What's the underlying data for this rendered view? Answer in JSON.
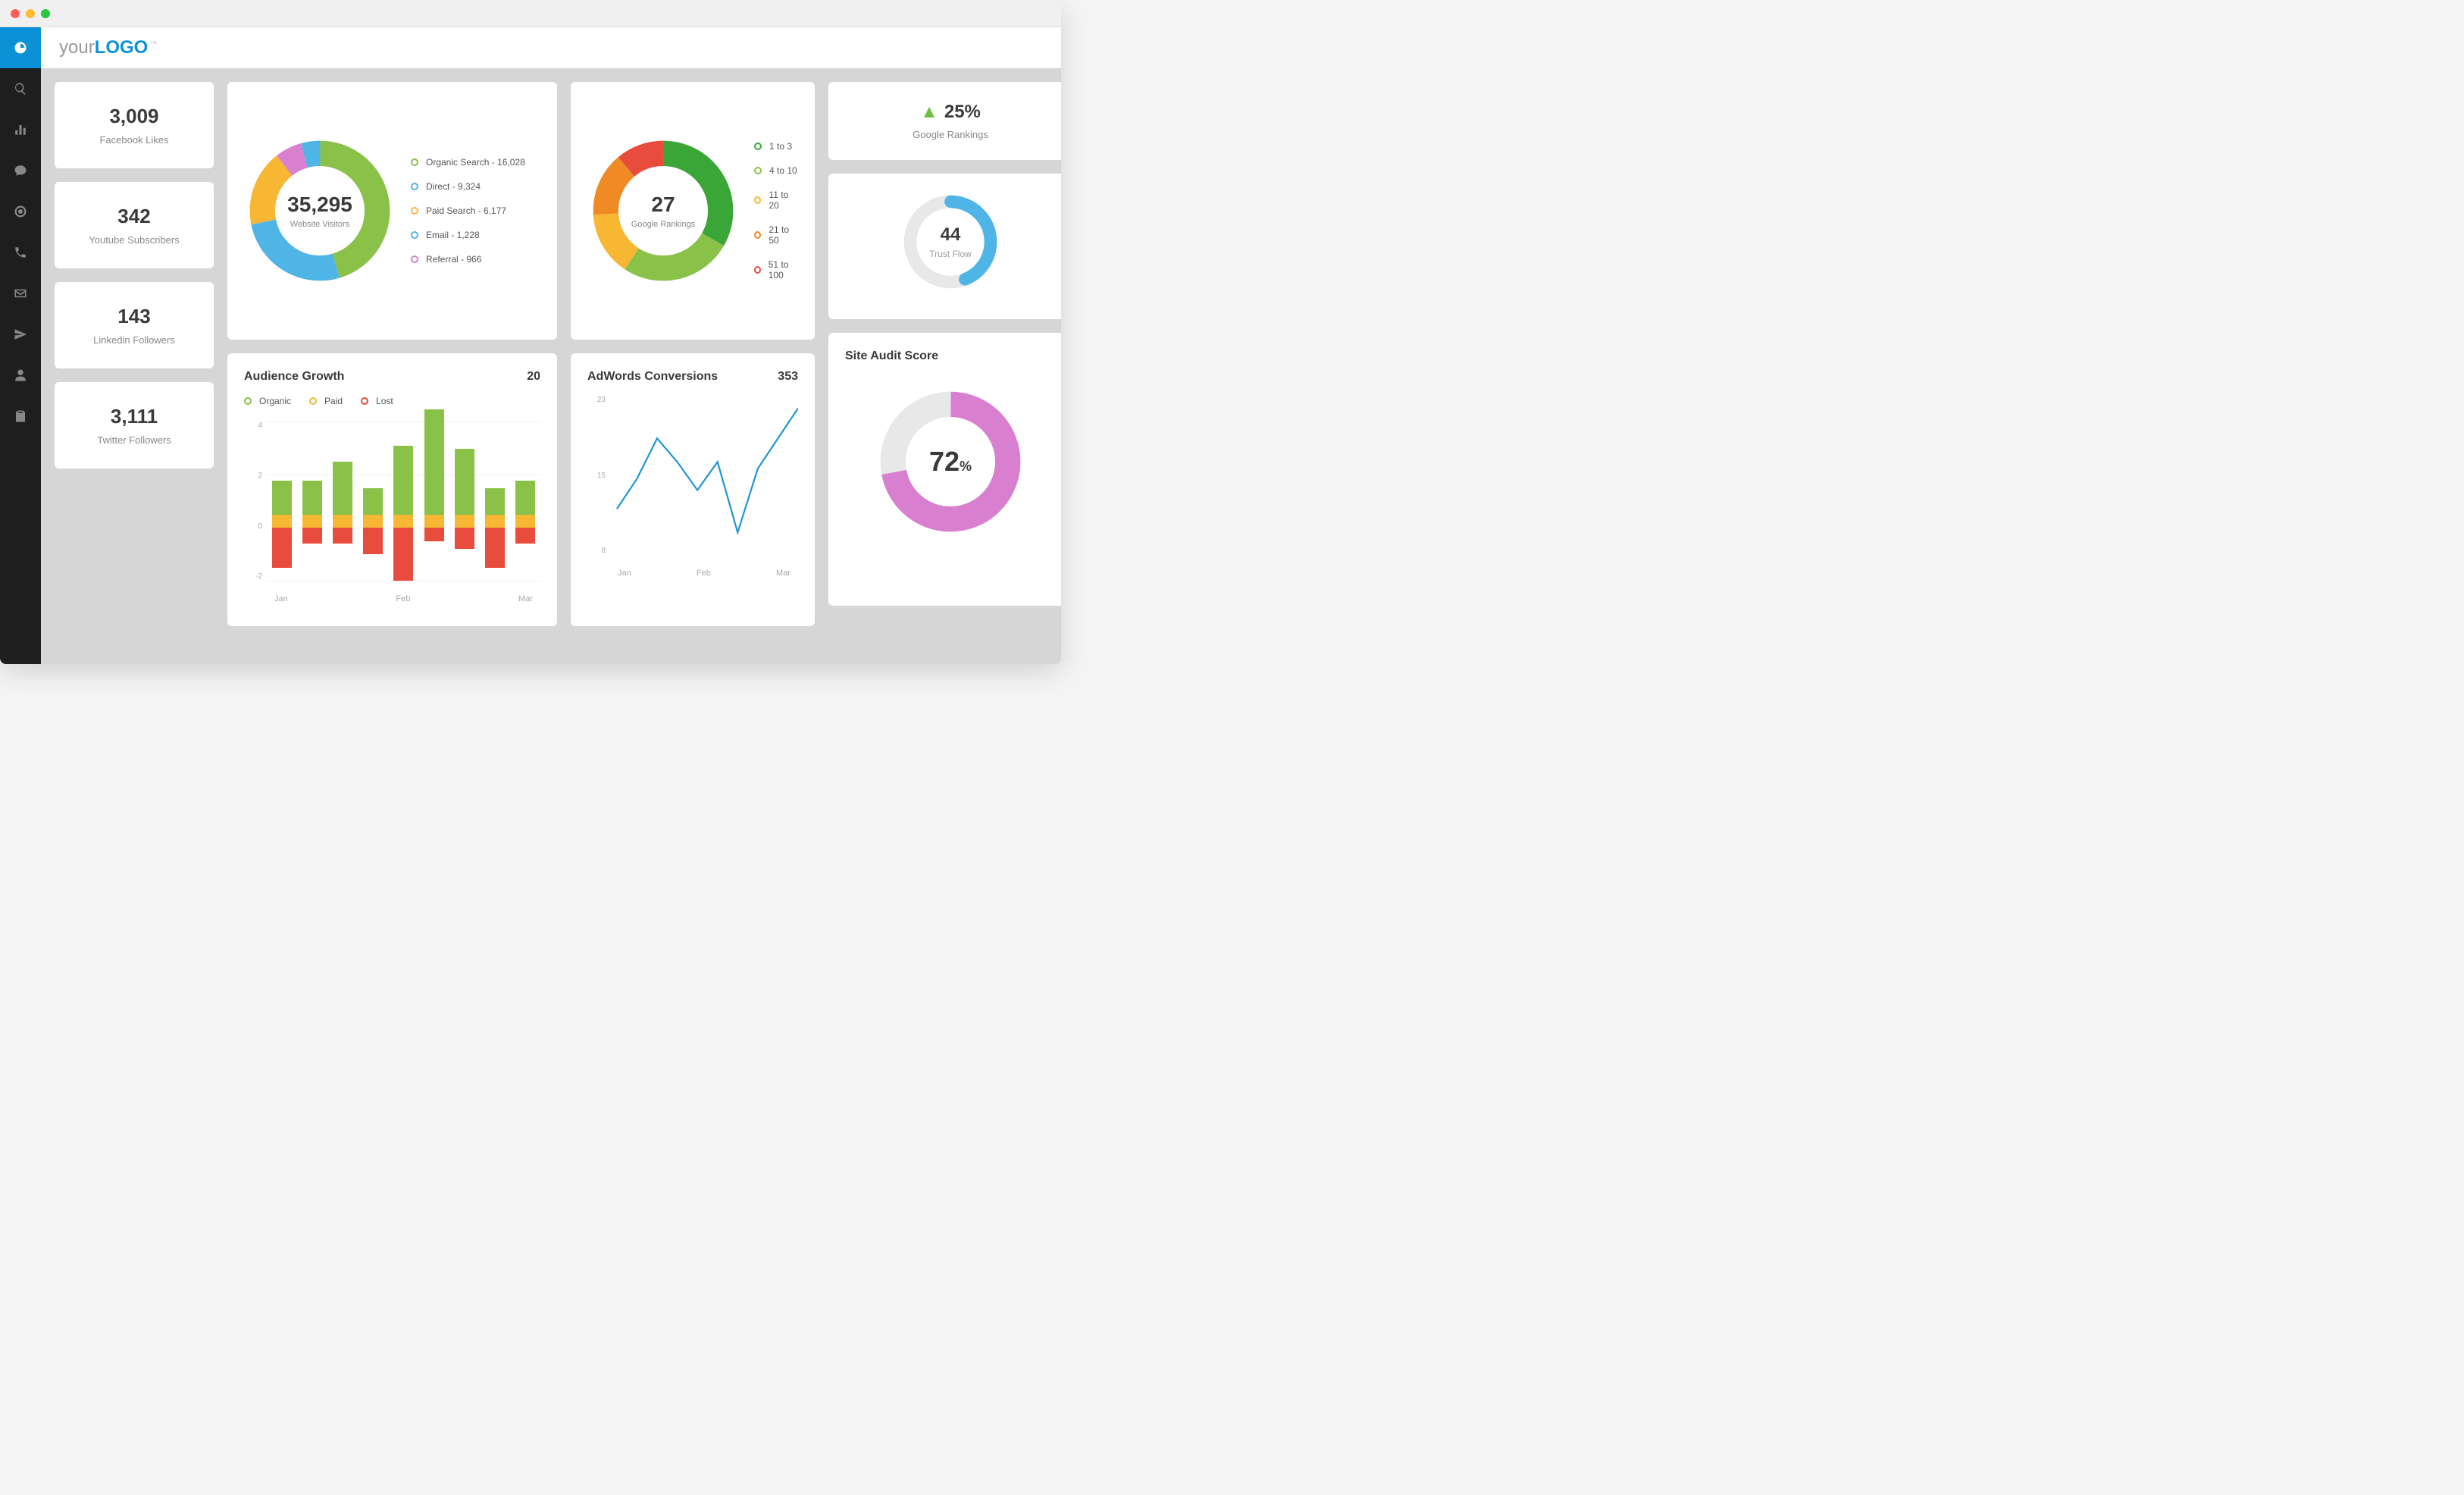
{
  "logo": {
    "pre": "your",
    "bold": "LOGO",
    "tm": "™"
  },
  "sidebar": {
    "items": [
      {
        "name": "dashboard-icon"
      },
      {
        "name": "search-icon"
      },
      {
        "name": "bar-chart-icon"
      },
      {
        "name": "chat-icon"
      },
      {
        "name": "target-icon"
      },
      {
        "name": "phone-icon"
      },
      {
        "name": "mail-icon"
      },
      {
        "name": "send-icon"
      },
      {
        "name": "user-icon"
      },
      {
        "name": "clipboard-icon"
      }
    ]
  },
  "stats": {
    "facebook_likes": {
      "value": "3,009",
      "label": "Facebook Likes"
    },
    "youtube": {
      "value": "342",
      "label": "Youtube Subscribers"
    },
    "linkedin": {
      "value": "143",
      "label": "Linkedin Followers"
    },
    "twitter": {
      "value": "3,111",
      "label": "Twitter Followers"
    }
  },
  "website_visitors": {
    "total": "35,295",
    "label": "Website Visitors",
    "legend": [
      {
        "label": "Organic Search - 16,028",
        "color": "#8ac149"
      },
      {
        "label": "Direct - 9,324",
        "color": "#4fb5e6"
      },
      {
        "label": "Paid Search - 6,177",
        "color": "#f7b733"
      },
      {
        "label": "Email - 1,228",
        "color": "#4fb5e6"
      },
      {
        "label": "Referral - 966",
        "color": "#d97fd0"
      }
    ]
  },
  "google_rankings": {
    "total": "27",
    "label": "Google Rankings",
    "legend": [
      {
        "label": "1 to 3",
        "color": "#3ba638"
      },
      {
        "label": "4 to 10",
        "color": "#8ac149"
      },
      {
        "label": "11 to 20",
        "color": "#f7b733"
      },
      {
        "label": "21 to 50",
        "color": "#f08a24"
      },
      {
        "label": "51 to 100",
        "color": "#e84c3d"
      }
    ]
  },
  "google_rankings_change": {
    "value": "25%",
    "label": "Google Rankings"
  },
  "trust_flow": {
    "value": "44",
    "label": "Trust Flow"
  },
  "audience_growth": {
    "title": "Audience Growth",
    "total": "20",
    "legend": [
      {
        "label": "Organic",
        "color": "#8ac149"
      },
      {
        "label": "Paid",
        "color": "#f7b733"
      },
      {
        "label": "Lost",
        "color": "#e84c3d"
      }
    ],
    "xaxis": [
      "Jan",
      "Feb",
      "Mar"
    ]
  },
  "adwords": {
    "title": "AdWords Conversions",
    "total": "353",
    "xaxis": [
      "Jan",
      "Feb",
      "Mar"
    ],
    "yticks": [
      "23",
      "15",
      "8"
    ]
  },
  "site_audit": {
    "title": "Site Audit Score",
    "value": "72",
    "pct": "%"
  },
  "chart_data": [
    {
      "type": "pie",
      "title": "Website Visitors",
      "total": 35295,
      "series": [
        {
          "name": "Organic Search",
          "value": 16028,
          "color": "#8ac149"
        },
        {
          "name": "Direct",
          "value": 9324,
          "color": "#4fb5e6"
        },
        {
          "name": "Paid Search",
          "value": 6177,
          "color": "#f7b733"
        },
        {
          "name": "Email",
          "value": 1228,
          "color": "#4fb5e6"
        },
        {
          "name": "Referral",
          "value": 966,
          "color": "#d97fd0"
        }
      ],
      "layout": "donut"
    },
    {
      "type": "pie",
      "title": "Google Rankings",
      "total": 27,
      "series": [
        {
          "name": "1 to 3",
          "value": 9,
          "color": "#3ba638"
        },
        {
          "name": "4 to 10",
          "value": 7,
          "color": "#8ac149"
        },
        {
          "name": "11 to 20",
          "value": 4,
          "color": "#f7b733"
        },
        {
          "name": "21 to 50",
          "value": 4,
          "color": "#f08a24"
        },
        {
          "name": "51 to 100",
          "value": 3,
          "color": "#e84c3d"
        }
      ],
      "layout": "donut"
    },
    {
      "type": "bar",
      "title": "Audience Growth",
      "stacked": true,
      "categories": [
        "Jan",
        "",
        "",
        "",
        "Feb",
        "",
        "",
        "",
        "Mar"
      ],
      "series": [
        {
          "name": "Organic",
          "color": "#8ac149",
          "values": [
            1.3,
            1.3,
            2.0,
            1.0,
            2.6,
            4.0,
            2.5,
            1.0,
            1.3
          ]
        },
        {
          "name": "Paid",
          "color": "#f7b733",
          "values": [
            0.5,
            0.5,
            0.5,
            0.5,
            0.5,
            0.5,
            0.5,
            0.5,
            0.5
          ]
        },
        {
          "name": "Lost",
          "color": "#e84c3d",
          "values": [
            -1.5,
            -0.6,
            -0.6,
            -1.0,
            -2.0,
            -0.5,
            -0.8,
            -1.5,
            -0.6
          ]
        }
      ],
      "ylim": [
        -2,
        4
      ],
      "yticks": [
        -2,
        0,
        2,
        4
      ]
    },
    {
      "type": "line",
      "title": "AdWords Conversions",
      "x": [
        1,
        2,
        3,
        4,
        5,
        6,
        7,
        8,
        9,
        10
      ],
      "values": [
        6,
        11,
        18,
        14,
        9,
        14,
        2,
        13,
        18,
        23
      ],
      "ylim": [
        0,
        23
      ],
      "yticks": [
        8,
        15,
        23
      ],
      "xaxis": [
        "Jan",
        "Feb",
        "Mar"
      ],
      "color": "#2196d6",
      "total": 353
    },
    {
      "type": "pie",
      "title": "Trust Flow",
      "layout": "donut-gauge",
      "value": 44,
      "max": 100,
      "color": "#4fb5e6"
    },
    {
      "type": "pie",
      "title": "Site Audit Score",
      "layout": "donut-gauge",
      "value": 72,
      "max": 100,
      "color": "#d97fd0"
    }
  ]
}
